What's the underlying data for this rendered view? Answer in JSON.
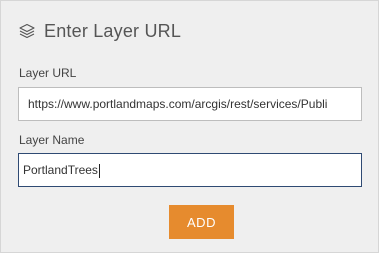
{
  "header": {
    "icon": "layers-icon",
    "title": "Enter Layer URL"
  },
  "url_field": {
    "label": "Layer URL",
    "value": "https://www.portlandmaps.com/arcgis/rest/services/Publi"
  },
  "name_field": {
    "label": "Layer Name",
    "value": "PortlandTrees"
  },
  "add_button": {
    "label": "ADD"
  },
  "colors": {
    "panel_bg": "#efefef",
    "accent": "#e68b2e",
    "focus_border": "#2f4a73"
  }
}
